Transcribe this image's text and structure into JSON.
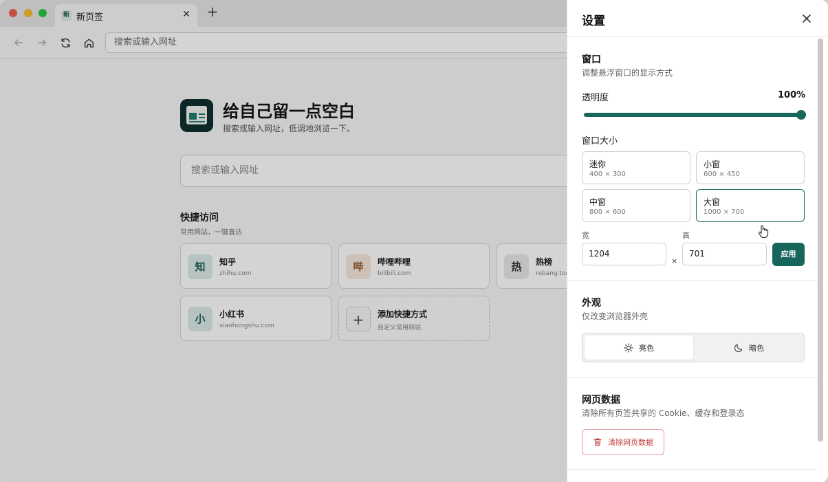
{
  "browser": {
    "tab": {
      "favicon": "新",
      "title": "新页签",
      "close": "✕"
    },
    "new_tab": "+",
    "address_placeholder": "搜索或输入网址"
  },
  "newtab": {
    "hero_title": "给自己留一点空白",
    "hero_subtitle": "搜索或输入网址，低调地浏览一下。",
    "search_placeholder": "搜索或输入网址",
    "quick_title": "快捷访问",
    "quick_subtitle": "常用网站，一键直达",
    "shortcuts": [
      {
        "icon": "知",
        "name": "知乎",
        "url": "zhihu.com",
        "icon_color": "#1b5e55",
        "icon_bg": "#dcebe7"
      },
      {
        "icon": "哔",
        "name": "哔哩哔哩",
        "url": "bilibili.com",
        "icon_color": "#9a5a2e",
        "icon_bg": "#f6e7dc"
      },
      {
        "icon": "热",
        "name": "热榜",
        "url": "rebang.today",
        "icon_color": "#333333",
        "icon_bg": "#e8e8e8"
      },
      {
        "icon": "小",
        "name": "小红书",
        "url": "xiaohongshu.com",
        "icon_color": "#1b5e55",
        "icon_bg": "#dcebe7"
      }
    ],
    "add_shortcut": {
      "icon": "+",
      "name": "添加快捷方式",
      "subtitle": "自定义常用网站"
    }
  },
  "settings": {
    "title": "设置",
    "window": {
      "title": "窗口",
      "subtitle": "调整悬浮窗口的显示方式",
      "opacity_label": "透明度",
      "opacity_value": "100%",
      "opacity_fraction": 1.0,
      "size_label": "窗口大小",
      "sizes": [
        {
          "name": "迷你",
          "dims": "400 × 300"
        },
        {
          "name": "小窗",
          "dims": "600 × 450"
        },
        {
          "name": "中窗",
          "dims": "800 × 600"
        },
        {
          "name": "大窗",
          "dims": "1000 × 700",
          "selected": true
        }
      ],
      "width_label": "宽",
      "height_label": "高",
      "width_value": "1204",
      "height_value": "701",
      "times": "×",
      "apply": "应用"
    },
    "appearance": {
      "title": "外观",
      "subtitle": "仅改变浏览器外壳",
      "light": "亮色",
      "dark": "暗色",
      "selected": "light"
    },
    "web_data": {
      "title": "网页数据",
      "subtitle": "清除所有页签共享的 Cookie、缓存和登录态",
      "clear_button": "清除网页数据"
    }
  },
  "colors": {
    "accent": "#17665c",
    "danger": "#c23a3a"
  }
}
